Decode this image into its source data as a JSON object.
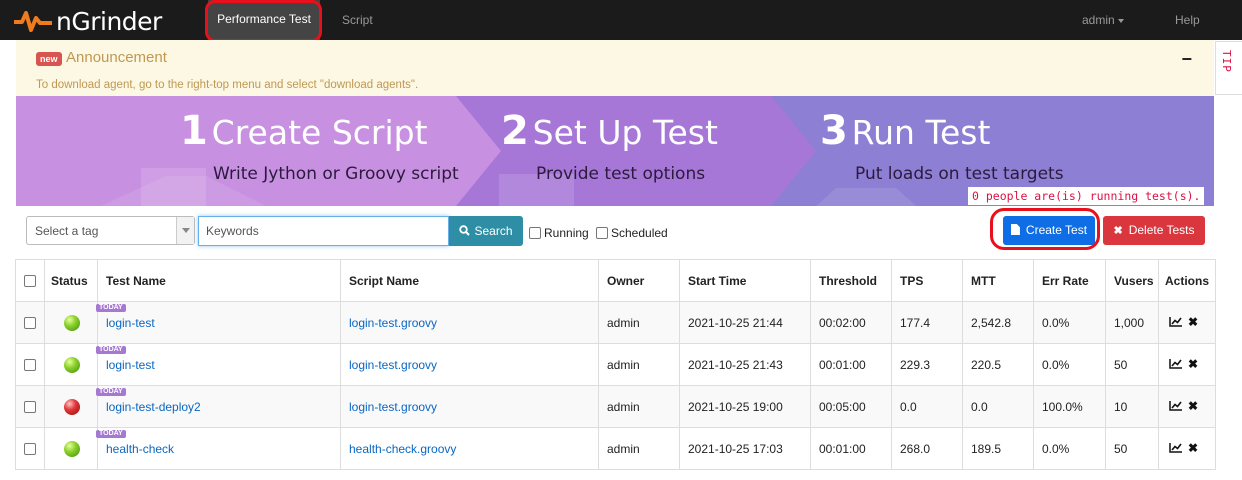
{
  "app": {
    "title": "nGrinder"
  },
  "nav": {
    "tabs": [
      {
        "label": "Performance Test",
        "active": true
      },
      {
        "label": "Script",
        "active": false
      }
    ],
    "user": "admin",
    "help": "Help"
  },
  "announcement": {
    "badge": "new",
    "title": "Announcement",
    "collapse_symbol": "−",
    "text": "To download agent, go to the right-top menu and select \"download agents\"."
  },
  "tip": {
    "label": "TIP"
  },
  "banner": {
    "steps": [
      {
        "number": "1",
        "title": "Create Script",
        "subtitle": "Write Jython or Groovy script"
      },
      {
        "number": "2",
        "title": "Set Up Test",
        "subtitle": "Provide test options"
      },
      {
        "number": "3",
        "title": "Run Test",
        "subtitle": "Put loads on test targets"
      }
    ],
    "colors": {
      "step1": "#c58ae0",
      "step2": "#a777d8",
      "step3": "#8d7fd3"
    }
  },
  "running_count": "0 people are(is) running test(s).",
  "toolbar": {
    "tag_placeholder": "Select a tag",
    "keyword_placeholder": "Keywords",
    "search_label": "Search",
    "running_label": "Running",
    "scheduled_label": "Scheduled",
    "create_label": "Create Test",
    "delete_label": "Delete Tests",
    "colors": {
      "search": "#2e8ea6",
      "create": "#0f6ee6",
      "delete": "#d9363e"
    }
  },
  "table": {
    "headers": [
      "Status",
      "Test Name",
      "Script Name",
      "Owner",
      "Start Time",
      "Threshold",
      "TPS",
      "MTT",
      "Err Rate",
      "Vusers",
      "Actions"
    ],
    "today_badge": "TODAY",
    "rows": [
      {
        "status": "green",
        "status_icon": "green-ball-icon",
        "test_name": "login-test",
        "script_name": "login-test.groovy",
        "owner": "admin",
        "start_time": "2021-10-25 21:44",
        "threshold": "00:02:00",
        "tps": "177.4",
        "mtt": "2,542.8",
        "err_rate": "0.0%",
        "vusers": "1,000"
      },
      {
        "status": "green",
        "status_icon": "green-ball-icon",
        "test_name": "login-test",
        "script_name": "login-test.groovy",
        "owner": "admin",
        "start_time": "2021-10-25 21:43",
        "threshold": "00:01:00",
        "tps": "229.3",
        "mtt": "220.5",
        "err_rate": "0.0%",
        "vusers": "50"
      },
      {
        "status": "red",
        "status_icon": "red-ball-icon",
        "test_name": "login-test-deploy2",
        "script_name": "login-test.groovy",
        "owner": "admin",
        "start_time": "2021-10-25 19:00",
        "threshold": "00:05:00",
        "tps": "0.0",
        "mtt": "0.0",
        "err_rate": "100.0%",
        "vusers": "10"
      },
      {
        "status": "green",
        "status_icon": "green-ball-icon",
        "test_name": "health-check",
        "script_name": "health-check.groovy",
        "owner": "admin",
        "start_time": "2021-10-25 17:03",
        "threshold": "00:01:00",
        "tps": "268.0",
        "mtt": "189.5",
        "err_rate": "0.0%",
        "vusers": "50"
      }
    ]
  }
}
